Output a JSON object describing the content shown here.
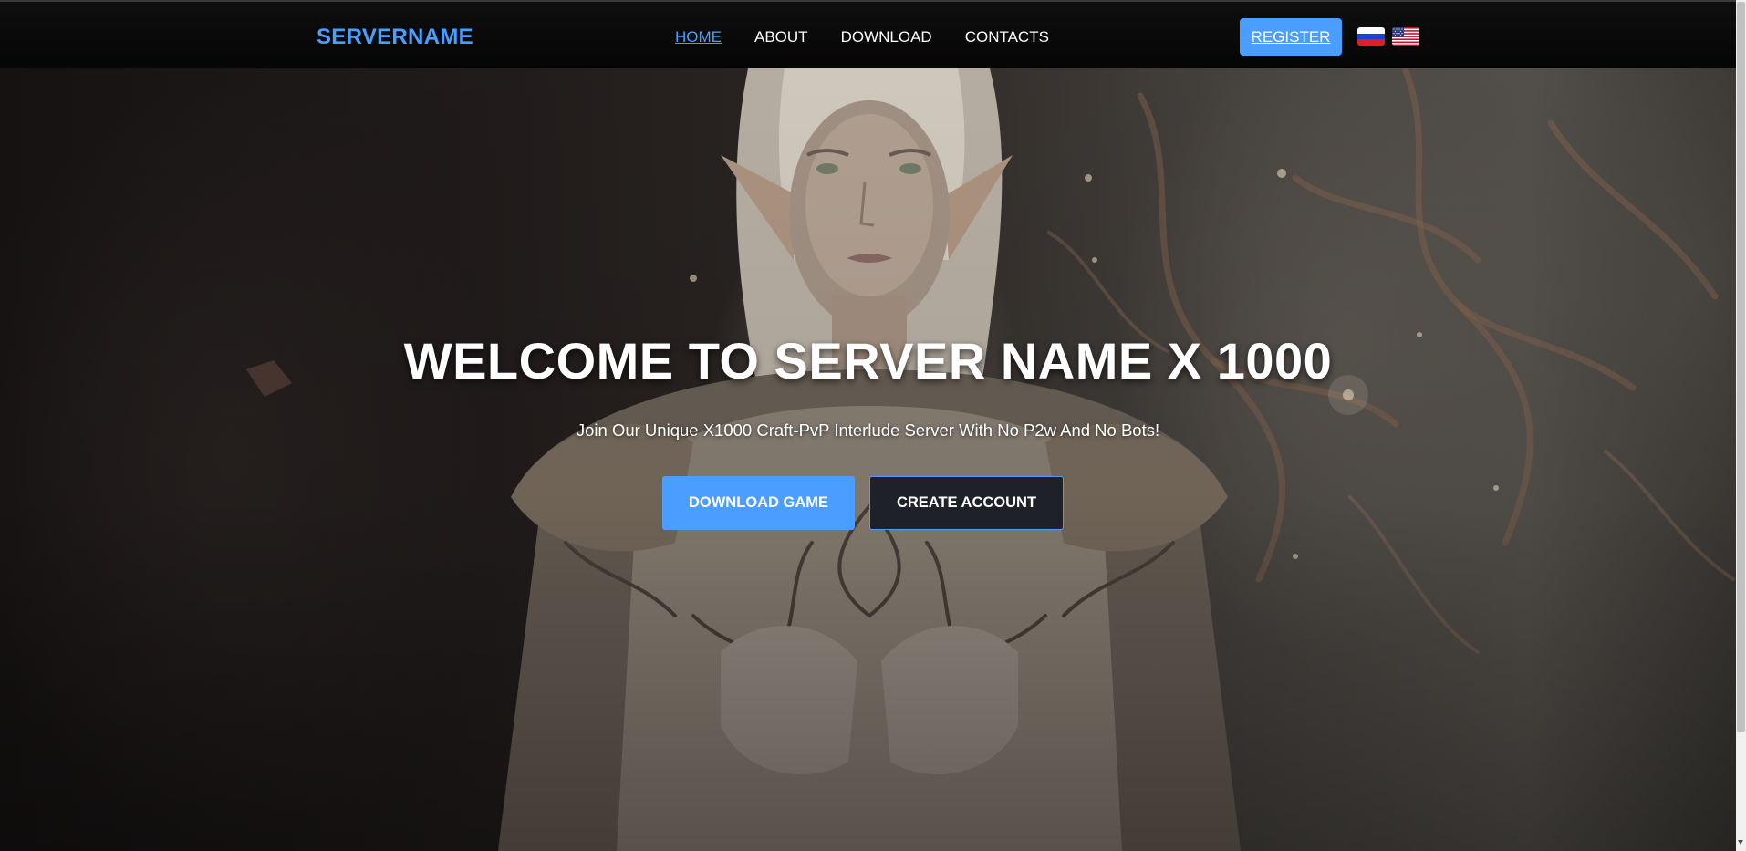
{
  "nav": {
    "logo": "SERVERNAME",
    "links": [
      {
        "label": "HOME",
        "active": true
      },
      {
        "label": "ABOUT",
        "active": false
      },
      {
        "label": "DOWNLOAD",
        "active": false
      },
      {
        "label": "CONTACTS",
        "active": false
      }
    ],
    "register_label": "REGISTER",
    "languages": [
      {
        "icon": "russia-flag-icon"
      },
      {
        "icon": "usa-flag-icon"
      }
    ]
  },
  "hero": {
    "title": "WELCOME TO SERVER NAME X 1000",
    "subtitle": "Join Our Unique X1000 Craft-PvP Interlude Server With No P2w And No Bots!",
    "primary_button": "DOWNLOAD GAME",
    "secondary_button": "CREATE ACCOUNT",
    "background": "fantasy-elf-warrior-illustration"
  },
  "colors": {
    "accent": "#4a9eff",
    "navbar": "#080808",
    "secondary_button_bg": "#1e2128"
  }
}
